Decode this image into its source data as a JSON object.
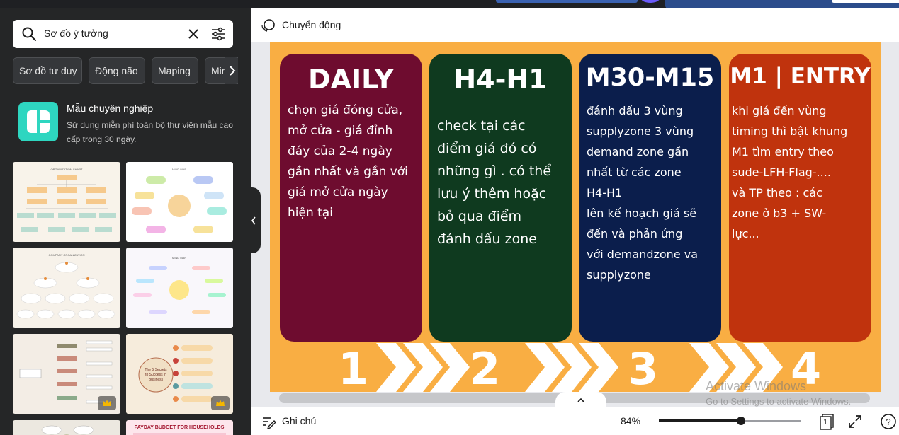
{
  "search": {
    "value": "Sơ đồ ý tưởng"
  },
  "chips": [
    "Sơ đồ tư duy",
    "Động não",
    "Maping",
    "Min"
  ],
  "promo": {
    "title": "Mẫu chuyên nghiệp",
    "description": "Sử dụng miễn phí toàn bộ thư viện mẫu cao cấp trong 30 ngày."
  },
  "thumbnails": [
    {
      "title": "ORGANIZATION CHART",
      "premium": false
    },
    {
      "title": "MIND MAP",
      "premium": false
    },
    {
      "title": "COMPANY ORGANIZATION",
      "premium": false
    },
    {
      "title": "MIND MAP",
      "premium": false
    },
    {
      "title": "",
      "premium": true
    },
    {
      "title": "The 5 Secrets to Success in Business",
      "premium": true
    },
    {
      "title": "",
      "premium": false
    },
    {
      "title": "PAYDAY BUDGET FOR HOUSEHOLDS",
      "premium": false
    }
  ],
  "editor": {
    "motion_label": "Chuyển động",
    "notes_label": "Ghi chú",
    "zoom": "84%",
    "zoom_fraction": 0.84,
    "page_count": "1"
  },
  "cards": [
    {
      "title": "DAILY",
      "body": "chọn giá đóng cửa,\nmở cửa - giá đỉnh\nđáy của 2-4 ngày\ngần nhất và gần với\ngiá mở cửa ngày\nhiện tại",
      "color": "#6e0c2f"
    },
    {
      "title": "H4-H1",
      "body": "check tại các\nđiểm giá đó có\nnhững gì . có thể\nlưu ý thêm hoặc\nbỏ qua điểm\nđánh dấu zone",
      "color": "#0f3a1f"
    },
    {
      "title": "M30-M15",
      "body": "đánh dấu 3 vùng\nsupplyzone 3 vùng\ndemand zone gần\nnhất từ các zone\nH4-H1\nlên kế hoạch giá sẽ\nđến và phản ứng\nvới demandzone va\nsupplyzone",
      "color": "#0b1e4c"
    },
    {
      "title": "M1 | ENTRY",
      "body": "khi giá đến vùng\ntiming thì bật khung\nM1 tìm entry theo\nsude-LFH-Flag-....\nvà TP theo : các\nzone ở b3 + SW-\nlực...",
      "color": "#c0330d"
    }
  ],
  "steps": [
    "1",
    "2",
    "3",
    "4"
  ],
  "watermark": {
    "title": "Activate Windows",
    "subtitle": "Go to Settings to activate Windows."
  },
  "colors": {
    "canvas_bg": "#f9ae43",
    "panel_bg": "#252627",
    "promo_icon": "#2ed6c0"
  }
}
